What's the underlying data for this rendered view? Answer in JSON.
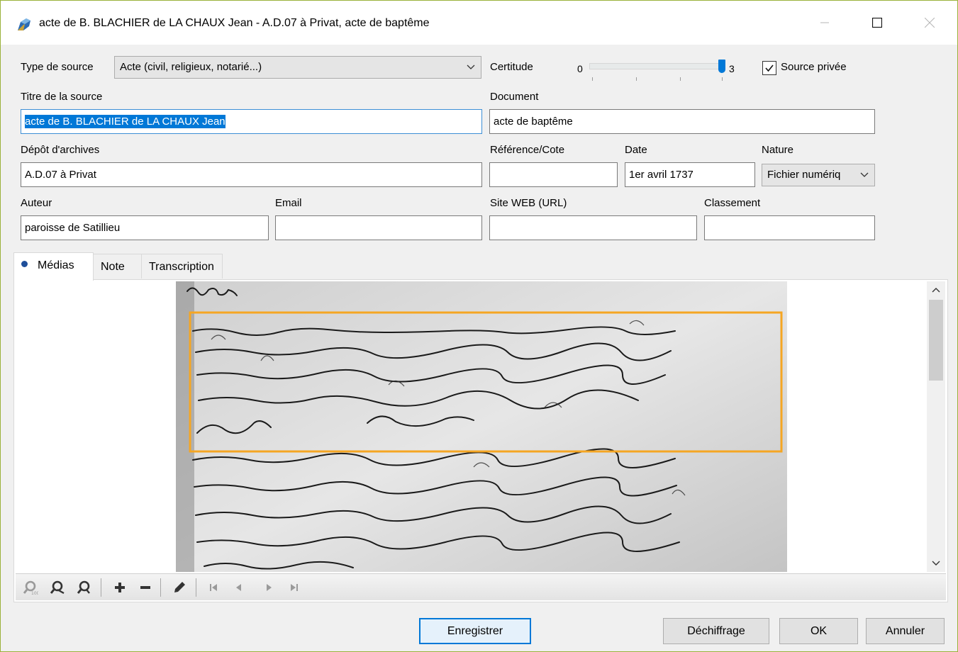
{
  "window": {
    "title": "acte de B. BLACHIER de LA CHAUX Jean - A.D.07 à Privat, acte de baptême",
    "min_icon": "minimize-icon",
    "max_icon": "maximize-icon",
    "close_icon": "close-icon"
  },
  "form": {
    "type_source_label": "Type de source",
    "type_source_value": "Acte (civil, religieux, notarié...)",
    "certitude_label": "Certitude",
    "certitude_min": "0",
    "certitude_max": "3",
    "certitude_value": 3,
    "source_privee_label": "Source privée",
    "source_privee_checked": true,
    "titre_label": "Titre de la source",
    "titre_value": "acte de B. BLACHIER de LA CHAUX Jean",
    "document_label": "Document",
    "document_value": "acte de baptême",
    "depot_label": "Dépôt d'archives",
    "depot_value": "A.D.07 à Privat",
    "reference_label": "Référence/Cote",
    "reference_value": "",
    "date_label": "Date",
    "date_value": "1er avril 1737",
    "nature_label": "Nature",
    "nature_value": "Fichier numériq",
    "auteur_label": "Auteur",
    "auteur_value": "paroisse de Satillieu",
    "email_label": "Email",
    "email_value": "",
    "site_label": "Site WEB (URL)",
    "site_value": "",
    "classement_label": "Classement",
    "classement_value": ""
  },
  "tabs": [
    {
      "label": "Médias",
      "active": true
    },
    {
      "label": "Note",
      "active": false
    },
    {
      "label": "Transcription",
      "active": false
    }
  ],
  "media_toolbar": {
    "icons": [
      "zoom-fit-icon",
      "zoom-actual-icon",
      "zoom-custom-icon",
      "add-icon",
      "remove-icon",
      "edit-icon",
      "first-icon",
      "previous-icon",
      "next-icon",
      "last-icon"
    ]
  },
  "buttons": {
    "enregistrer": "Enregistrer",
    "dechiffrage": "Déchiffrage",
    "ok": "OK",
    "annuler": "Annuler"
  },
  "colors": {
    "accent": "#0078d7",
    "selection_box": "#f5a623",
    "window_border": "#9ab23a"
  }
}
